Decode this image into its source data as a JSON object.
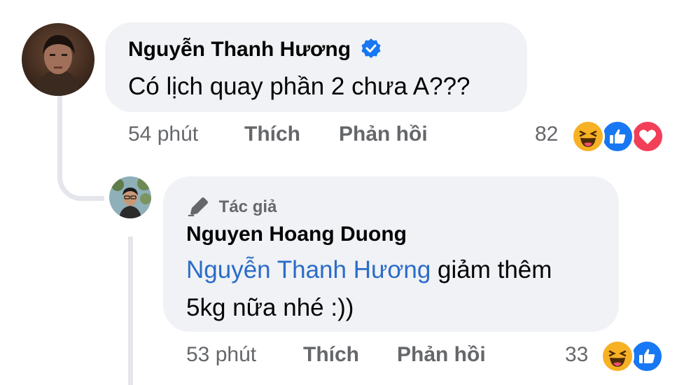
{
  "comment": {
    "author": "Nguyễn Thanh Hương",
    "text": "Có lịch quay phần 2 chưa A???",
    "time": "54 phút",
    "like_label": "Thích",
    "reply_label": "Phản hồi",
    "reaction_count": "82",
    "reactions": [
      "haha-icon",
      "like-icon",
      "love-icon"
    ]
  },
  "reply": {
    "author_tag": "Tác giả",
    "author": "Nguyen Hoang Duong",
    "mention": "Nguyễn Thanh Hương",
    "text_line1_rest": " giảm thêm",
    "text_line2": "5kg nữa nhé :))",
    "time": "53 phút",
    "like_label": "Thích",
    "reply_label": "Phản hồi",
    "reaction_count": "33",
    "reactions": [
      "haha-icon",
      "like-icon"
    ]
  },
  "colors": {
    "bubble": "#f0f2f5",
    "mention": "#2b6cc9",
    "meta": "#65676b",
    "verified": "#1877f2",
    "like": "#1877f2",
    "love": "#f33e58",
    "haha": "#f7b125"
  }
}
